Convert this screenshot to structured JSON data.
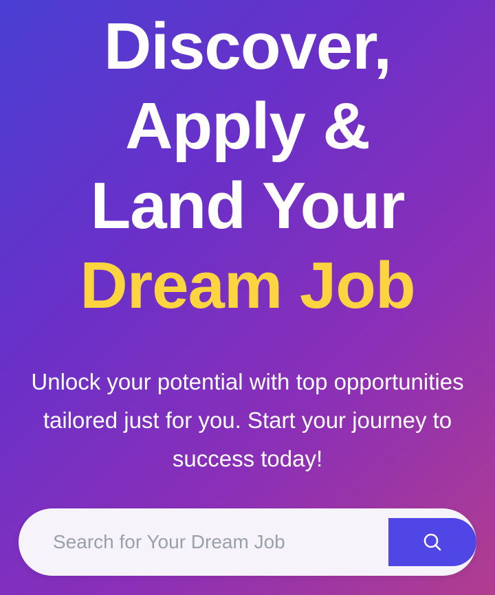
{
  "hero": {
    "headline_line1": "Discover,",
    "headline_line2": "Apply &",
    "headline_line3": "Land Your",
    "headline_line4": "Dream Job",
    "subtext": "Unlock your potential with top opportunities tailored just for you. Start your journey to success today!"
  },
  "search": {
    "placeholder": "Search for Your Dream Job",
    "value": "",
    "button_icon": "search-icon"
  },
  "colors": {
    "accent": "#fbd43f",
    "button": "#4f46e5",
    "gradient_start": "#4a3fd3",
    "gradient_end": "#b13d8f"
  }
}
